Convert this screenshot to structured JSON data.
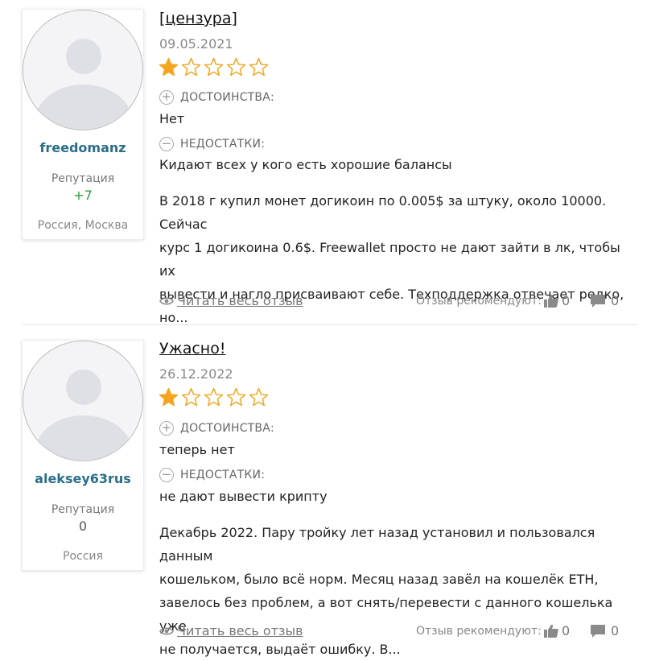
{
  "reviews": [
    {
      "username": "freedomanz",
      "reputation_label": "Репутация",
      "reputation_value": "+7",
      "location": "Россия, Москва",
      "title": "[цензура]",
      "date": "09.05.2021",
      "rating": 1,
      "rating_max": 5,
      "pros_label": "ДОСТОИНСТВА:",
      "pros_text": "Нет",
      "cons_label": "НЕДОСТАТКИ:",
      "cons_text": "Кидают всех у кого есть хорошие балансы",
      "body_lines": [
        "В 2018 г купил монет догикоин по 0.005$ за штуку, около 10000. Сейчас",
        "курс 1 догикоина 0.6$. Freewallet просто не дают зайти в лк, чтобы их",
        "вывести и нагло присваивают себе. Техподдержка отвечает редко,",
        "но..."
      ],
      "read_more": "Читать весь отзыв",
      "recommend_label": "Отзыв рекомендуют:",
      "likes": "0",
      "comments": "0"
    },
    {
      "username": "aleksey63rus",
      "reputation_label": "Репутация",
      "reputation_value": "0",
      "location": "Россия",
      "title": "Ужасно!",
      "date": "26.12.2022",
      "rating": 1,
      "rating_max": 5,
      "pros_label": "ДОСТОИНСТВА:",
      "pros_text": "теперь нет",
      "cons_label": "НЕДОСТАТКИ:",
      "cons_text": "не дают вывести крипту",
      "body_lines": [
        "Декабрь 2022. Пару тройку лет назад установил и пользовался данным",
        "кошельком, было всё норм. Месяц назад завёл на кошелёк ETH,",
        "завелось без проблем, а вот снять/перевести с данного кошелька уже",
        "не получается, выдаёт ошибку. В..."
      ],
      "read_more": "Читать весь отзыв",
      "recommend_label": "Отзыв рекомендуют:",
      "likes": "0",
      "comments": "0"
    }
  ],
  "icons": {
    "pros": "plus-circle-icon",
    "cons": "minus-circle-icon",
    "read": "eye-icon",
    "like": "thumbs-up-icon",
    "comment": "speech-bubble-icon",
    "star": "star-icon"
  },
  "colors": {
    "star_filled": "#f3a51f",
    "star_outline": "#f3a51f",
    "username": "#2a6f8a",
    "reputation_positive": "#2f9e3c"
  }
}
